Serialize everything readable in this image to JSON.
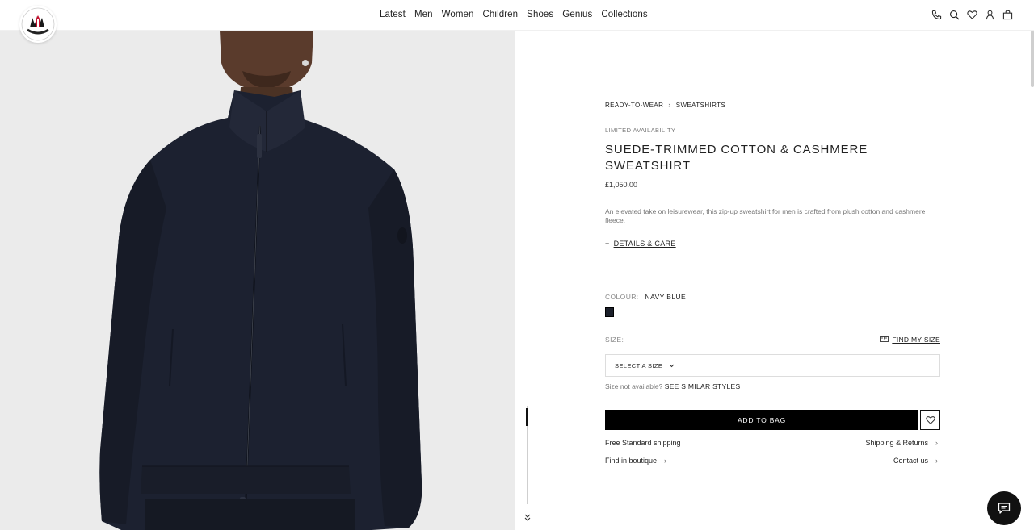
{
  "header": {
    "logo_icon": "moncler-logo-icon",
    "nav": [
      "Latest",
      "Men",
      "Women",
      "Children",
      "Shoes",
      "Genius",
      "Collections"
    ],
    "utility_icons": [
      "phone-icon",
      "search-icon",
      "heart-icon",
      "account-icon",
      "bag-icon"
    ]
  },
  "breadcrumb": [
    "READY-TO-WEAR",
    "SWEATSHIRTS"
  ],
  "product": {
    "availability": "LIMITED AVAILABILITY",
    "title": "SUEDE-TRIMMED COTTON & CASHMERE SWEATSHIRT",
    "price": "£1,050.00",
    "description": "An elevated take on leisurewear, this zip-up sweatshirt for men is crafted from plush cotton and cashmere fleece.",
    "details_link": "DETAILS & CARE",
    "colour_label": "COLOUR:",
    "colour_value": "NAVY BLUE",
    "swatch_color": "#1b1f2a",
    "size_label": "SIZE:",
    "find_size": "FIND MY SIZE",
    "size_placeholder": "SELECT A SIZE",
    "not_available_text": "Size not available?",
    "similar_styles": "SEE SIMILAR STYLES",
    "add_to_bag": "ADD TO BAG"
  },
  "service_links": {
    "free_shipping": "Free Standard shipping",
    "shipping_returns": "Shipping & Returns",
    "find_boutique": "Find in boutique",
    "contact_us": "Contact us"
  },
  "colors": {
    "accent": "#000000",
    "jacket": "#1c2130",
    "background": "#ebebeb"
  }
}
